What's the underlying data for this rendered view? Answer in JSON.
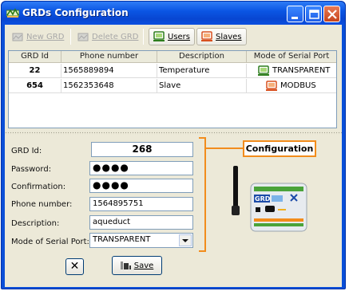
{
  "window": {
    "title": "GRDs Configuration"
  },
  "toolbar": {
    "new_grd": "New GRD",
    "delete_grd": "Delete GRD",
    "users": "Users",
    "slaves": "Slaves"
  },
  "table": {
    "columns": [
      "GRD Id",
      "Phone number",
      "Description",
      "Mode of Serial Port"
    ],
    "rows": [
      {
        "id": "22",
        "phone": "1565889894",
        "description": "Temperature",
        "mode": "TRANSPARENT",
        "mode_icon": "transparent-mode-icon"
      },
      {
        "id": "654",
        "phone": "1562353648",
        "description": "Slave",
        "mode": "MODBUS",
        "mode_icon": "modbus-mode-icon"
      }
    ]
  },
  "form": {
    "grd_id_label": "GRD Id:",
    "grd_id_value": "268",
    "password_label": "Password:",
    "password_value": "●●●●",
    "confirmation_label": "Confirmation:",
    "confirmation_value": "●●●●",
    "phone_label": "Phone number:",
    "phone_value": "1564895751",
    "description_label": "Description:",
    "description_value": "aqueduct",
    "mode_label": "Mode of Serial Port:",
    "mode_value": "TRANSPARENT",
    "configuration_label": "Configuration",
    "save_label": "Save",
    "cancel_glyph": "✕"
  },
  "colors": {
    "titlebar": "#0b56e4",
    "accent_orange": "#f28c1c",
    "panel": "#ece9d8"
  },
  "icons": {
    "title": "grd-app-icon",
    "users": "users-icon",
    "slaves": "slaves-icon",
    "device": "grd-device-icon"
  }
}
